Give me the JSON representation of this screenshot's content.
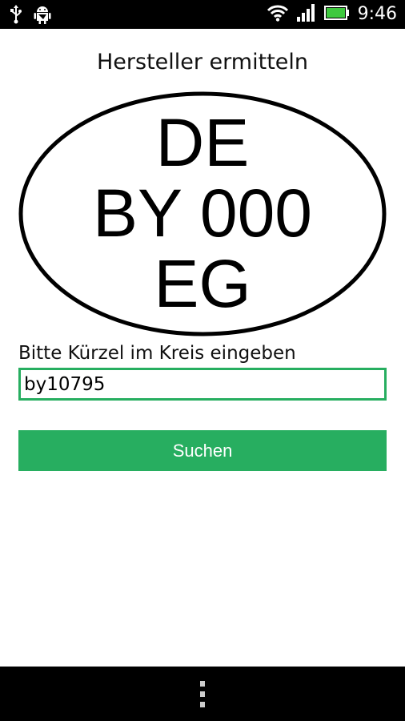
{
  "status_bar": {
    "time": "9:46",
    "icons": [
      "usb-icon",
      "android-debug-icon",
      "wifi-icon",
      "signal-icon",
      "battery-icon"
    ]
  },
  "page": {
    "title": "Hersteller ermitteln"
  },
  "plate": {
    "line1": "DE",
    "line2": "BY 000",
    "line3": "EG"
  },
  "form": {
    "label": "Bitte Kürzel im Kreis eingeben",
    "input_value": "by10795",
    "search_label": "Suchen"
  },
  "nav_bar": {
    "icons": [
      "menu-dots-icon"
    ]
  },
  "colors": {
    "accent": "#27ae60",
    "bar_background": "#000000",
    "battery_fill": "#3ec93e"
  }
}
